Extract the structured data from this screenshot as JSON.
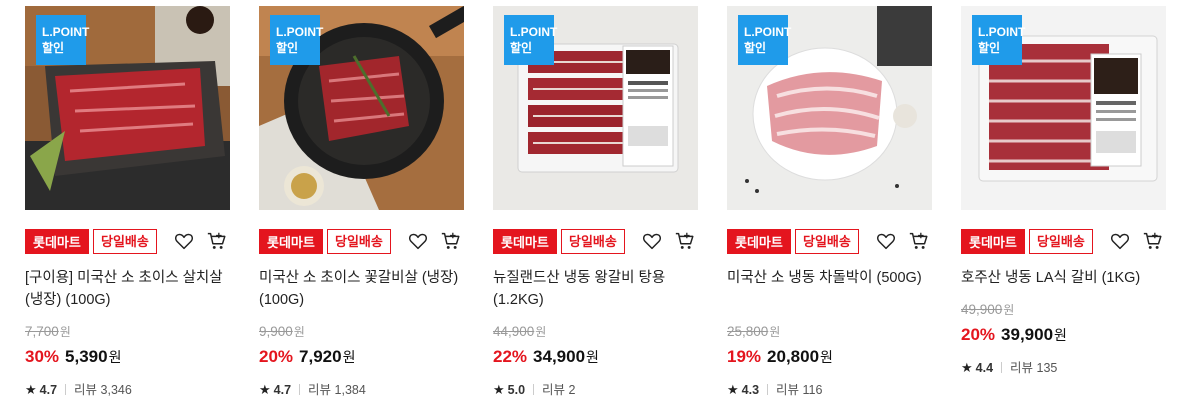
{
  "badge": {
    "line1": "L.POINT",
    "line2": "할인"
  },
  "tags": {
    "mart": "롯데마트",
    "delivery": "당일배송"
  },
  "currency": "원",
  "colors": {
    "accent_red": "#e4151e",
    "lpoint_blue": "#1f9bea"
  },
  "products": [
    {
      "title": "[구이용] 미국산 소 초이스 살치살 (냉장) (100G)",
      "original_price": "7,700",
      "discount_rate": "30%",
      "price": "5,390",
      "rating": "4.7",
      "review_label": "리뷰 3,346"
    },
    {
      "title": "미국산 소 초이스 꽃갈비살 (냉장) (100G)",
      "original_price": "9,900",
      "discount_rate": "20%",
      "price": "7,920",
      "rating": "4.7",
      "review_label": "리뷰 1,384"
    },
    {
      "title": "뉴질랜드산 냉동 왕갈비 탕용 (1.2KG)",
      "original_price": "44,900",
      "discount_rate": "22%",
      "price": "34,900",
      "rating": "5.0",
      "review_label": "리뷰 2"
    },
    {
      "title": "미국산 소 냉동 차돌박이 (500G)",
      "original_price": "25,800",
      "discount_rate": "19%",
      "price": "20,800",
      "rating": "4.3",
      "review_label": "리뷰 116"
    },
    {
      "title": "호주산 냉동 LA식 갈비 (1KG)",
      "original_price": "49,900",
      "discount_rate": "20%",
      "price": "39,900",
      "rating": "4.4",
      "review_label": "리뷰 135"
    }
  ]
}
